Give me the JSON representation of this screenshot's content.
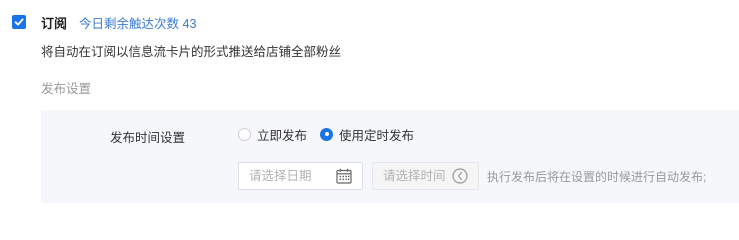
{
  "subscription": {
    "checked": true,
    "label": "订阅",
    "remaining_text": "今日剩余触达次数 43",
    "description": "将自动在订阅以信息流卡片的形式推送给店铺全部粉丝"
  },
  "publish_settings": {
    "section_title": "发布设置",
    "field_label": "发布时间设置",
    "options": [
      {
        "label": "立即发布",
        "selected": false
      },
      {
        "label": "使用定时发布",
        "selected": true
      }
    ],
    "date_placeholder": "请选择日期",
    "time_placeholder": "请选择时间",
    "hint": "执行发布后将在设置的时候进行自动发布;"
  },
  "colors": {
    "accent": "#1a73e8",
    "link": "#3a7bd5",
    "panel_bg": "#f5f7fa"
  },
  "icons": [
    "check-icon",
    "calendar-icon",
    "clock-icon"
  ]
}
